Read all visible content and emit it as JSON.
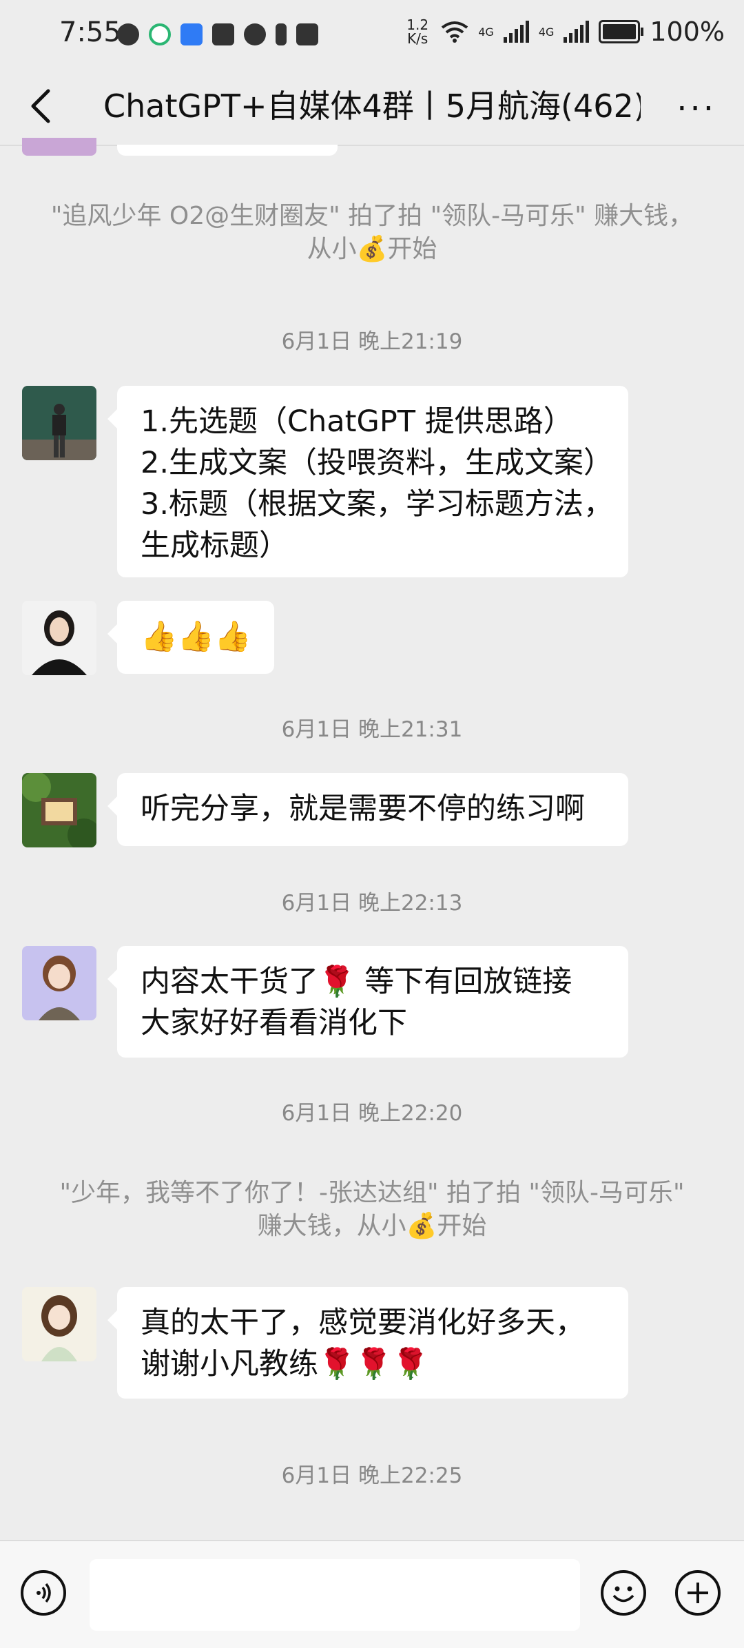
{
  "status_bar": {
    "time": "7:55",
    "net_speed_value": "1.2",
    "net_speed_unit": "K/s",
    "net_type_1": "4G",
    "net_type_2": "4G",
    "battery": "100%",
    "icons": [
      "wechat-icon",
      "sync-icon",
      "cloud-icon",
      "nfc-icon",
      "alarm-icon",
      "bluetooth-icon",
      "mute-icon",
      "wifi-icon",
      "signal-icon",
      "battery-icon"
    ]
  },
  "header": {
    "title": "ChatGPT+自媒体4群丨5月航海(462)",
    "back_icon": "chevron-left-icon",
    "more_label": "···"
  },
  "messages": {
    "sys1": "\"追风少年 O2@生财圈友\" 拍了拍 \"领队-马可乐\" 赚大钱，从小💰开始",
    "ts1": "6月1日 晚上21:19",
    "m1_line1": "1.先选题（ChatGPT 提供思路）",
    "m1_line2": "2.生成文案（投喂资料，生成文案）",
    "m1_line3": "3.标题（根据文案，学习标题方法，",
    "m1_line4": "生成标题）",
    "m2": "👍👍👍",
    "ts2": "6月1日 晚上21:31",
    "m3": "听完分享，就是需要不停的练习啊",
    "ts3": "6月1日 晚上22:13",
    "m4_line1": "内容太干货了🌹 等下有回放链接",
    "m4_line2": "大家好好看看消化下",
    "ts4": "6月1日 晚上22:20",
    "sys2": "\"少年，我等不了你了！-张达达组\" 拍了拍 \"领队-马可乐\" 赚大钱，从小💰开始",
    "m5_line1": "真的太干了，感觉要消化好多天，",
    "m5_line2": "谢谢小凡教练🌹🌹🌹",
    "ts5": "6月1日 晚上22:25"
  },
  "bottom_bar": {
    "voice_icon": "voice-icon",
    "input_value": "",
    "emoji_icon": "emoji-icon",
    "plus_icon": "plus-icon"
  },
  "colors": {
    "background": "#ededed",
    "bubble": "#ffffff",
    "timestamp": "#888888"
  }
}
